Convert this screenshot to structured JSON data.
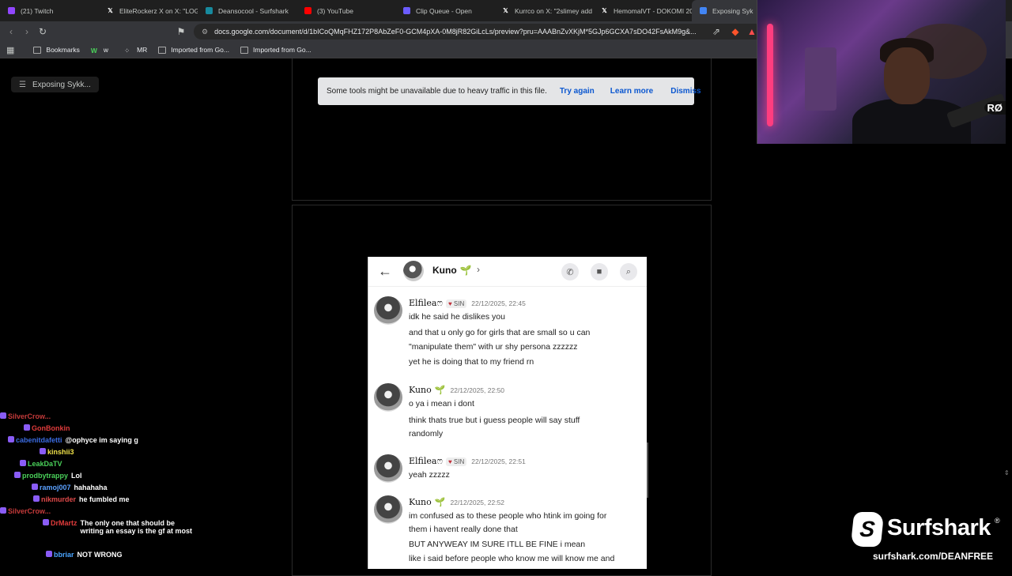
{
  "tabs": [
    {
      "title": "(21) Twitch",
      "icon": "twitch-icon",
      "color": "#9146ff"
    },
    {
      "title": "EliteRockerz X on X: \"LOG",
      "icon": "x-icon",
      "color": "#ffffff"
    },
    {
      "title": "Deansocool - Surfshark",
      "icon": "surfshark-icon",
      "color": "#178a9e"
    },
    {
      "title": "(3) YouTube",
      "icon": "youtube-icon",
      "color": "#ff0000"
    },
    {
      "title": "Clip Queue - Open",
      "icon": "clip-icon",
      "color": "#6b5cff"
    },
    {
      "title": "Kurrco on X: \"2slimey add",
      "icon": "x-icon",
      "color": "#ffffff"
    },
    {
      "title": "HemomalVT - DOKOMI 20",
      "icon": "x-icon",
      "color": "#ffffff"
    },
    {
      "title": "Exposing Syk",
      "icon": "docs-icon",
      "color": "#4285f4",
      "active": true
    }
  ],
  "address_bar": {
    "url": "docs.google.com/document/d/1bICoQMqFHZ172P8AbZeF0-GCM4pXA-0M8jR82GiLcLs/preview?pru=AAABnZvXKjM*5GJp6GCXA7sDO42FsAkM9g&..."
  },
  "bookmarks": [
    {
      "label": "Bookmarks",
      "icon": "bookmarks-icon"
    },
    {
      "label": "w",
      "icon": "w-icon"
    },
    {
      "label": "MR",
      "icon": "mr-icon"
    },
    {
      "label": "Imported from Go...",
      "icon": "folder-icon"
    },
    {
      "label": "Imported from Go...",
      "icon": "folder-icon"
    }
  ],
  "doc_outline": {
    "title": "Exposing Sykk..."
  },
  "banner": {
    "message": "Some tools might be unavailable due to heavy traffic in this file.",
    "try_again": "Try again",
    "learn_more": "Learn more",
    "dismiss": "Dismiss"
  },
  "discord": {
    "header_name": "Kuno",
    "messages": [
      {
        "author": "Elfilea",
        "author_suffix": "ෆ",
        "tag": "SIN",
        "time": "22/12/2025, 22:45",
        "lines": [
          "idk he said he dislikes you",
          "and that u only go for girls that are small so u can",
          "\"manipulate them\" with ur shy persona zzzzzz",
          "yet he is doing that to my friend rn"
        ]
      },
      {
        "author": "Kuno",
        "time": "22/12/2025, 22:50",
        "lines": [
          "o ya i mean i dont",
          "think thats true but i guess people will say stuff",
          "randomly"
        ]
      },
      {
        "author": "Elfilea",
        "author_suffix": "ෆ",
        "tag": "SIN",
        "time": "22/12/2025, 22:51",
        "lines": [
          "yeah zzzzz"
        ]
      },
      {
        "author": "Kuno",
        "time": "22/12/2025, 22:52",
        "lines": [
          "im confused as to these people who htink im going for",
          "them i havent really done that",
          "BUT ANYWEAY IM SURE ITLL BE FINE i mean",
          "like i said before people who know me will know me and"
        ]
      }
    ]
  },
  "chat": [
    {
      "user": "SilverCrow...",
      "color": "#c43a3a",
      "text": ""
    },
    {
      "user": "GonBonkin",
      "color": "#e03b3b",
      "text": ""
    },
    {
      "user": "cabenitdafetti",
      "color": "#3b6be0",
      "text": "@ophyce im saying g"
    },
    {
      "user": "kinshii3",
      "color": "#f0e24a",
      "text": ""
    },
    {
      "user": "LeakDaTV",
      "color": "#4ad15a",
      "text": ""
    },
    {
      "user": "prodbytrappy",
      "color": "#4ad15a",
      "text": "Lol"
    },
    {
      "user": "ramoj007",
      "color": "#5aa0ff",
      "text": "hahahaha"
    },
    {
      "user": "nikmurder",
      "color": "#e04a4a",
      "text": "he fumbled me"
    },
    {
      "user": "SilverCrow...",
      "color": "#c43a3a",
      "text": ""
    },
    {
      "user": "DrMartz",
      "color": "#e03b3b",
      "text": "The only one that should be writing an essay is the gf at most"
    },
    {
      "user": "bbriar",
      "color": "#4aa5ff",
      "text": "NOT WRONG"
    }
  ],
  "sponsor": {
    "brand": "Surfshark",
    "reg": "®",
    "url": "surfshark.com/DEANFREE",
    "logo_letter": "S"
  },
  "webcam": {
    "logo_text": "RØ"
  }
}
